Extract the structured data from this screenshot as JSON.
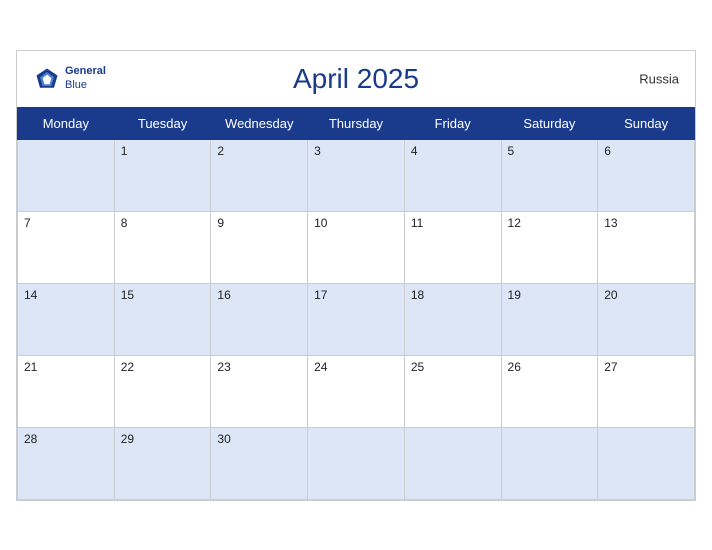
{
  "header": {
    "title": "April 2025",
    "country": "Russia",
    "logo_general": "General",
    "logo_blue": "Blue"
  },
  "days_of_week": [
    "Monday",
    "Tuesday",
    "Wednesday",
    "Thursday",
    "Friday",
    "Saturday",
    "Sunday"
  ],
  "weeks": [
    [
      "",
      "1",
      "2",
      "3",
      "4",
      "5",
      "6"
    ],
    [
      "7",
      "8",
      "9",
      "10",
      "11",
      "12",
      "13"
    ],
    [
      "14",
      "15",
      "16",
      "17",
      "18",
      "19",
      "20"
    ],
    [
      "21",
      "22",
      "23",
      "24",
      "25",
      "26",
      "27"
    ],
    [
      "28",
      "29",
      "30",
      "",
      "",
      "",
      ""
    ]
  ]
}
